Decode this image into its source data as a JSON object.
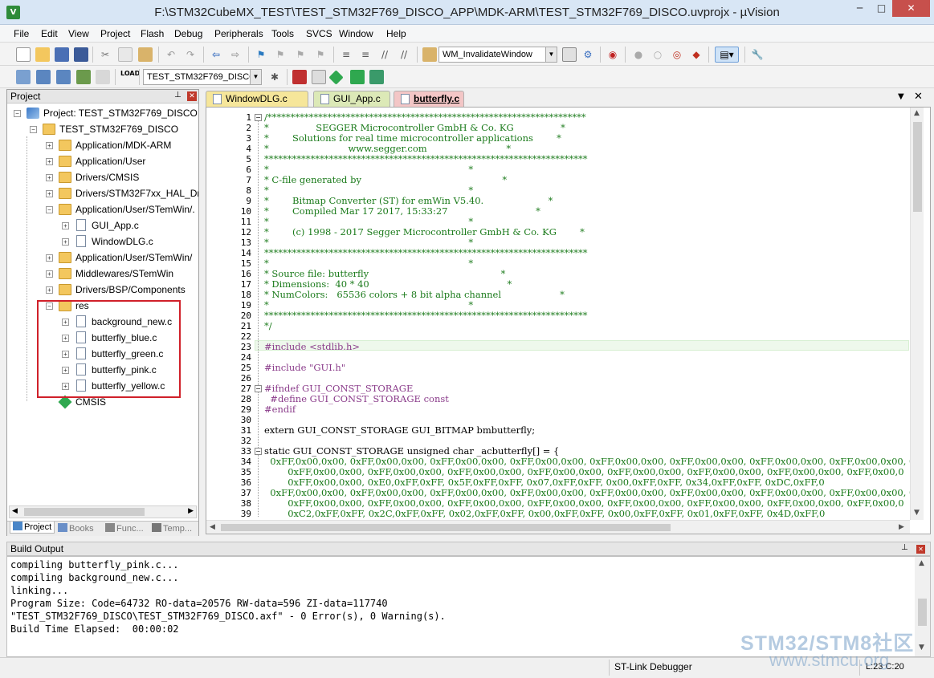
{
  "window": {
    "title": "F:\\STM32CubeMX_TEST\\TEST_STM32F769_DISCO_APP\\MDK-ARM\\TEST_STM32F769_DISCO.uvprojx - µVision",
    "min": "─",
    "max": "□",
    "close": "✕"
  },
  "menu": [
    "File",
    "Edit",
    "View",
    "Project",
    "Flash",
    "Debug",
    "Peripherals",
    "Tools",
    "SVCS",
    "Window",
    "Help"
  ],
  "toolbar": {
    "find_combo": "WM_InvalidateWindow",
    "target_combo": "TEST_STM32F769_DISCO"
  },
  "project_panel": {
    "title": "Project",
    "tree": [
      {
        "label": "Project: TEST_STM32F769_DISCO",
        "icon": "project-icon"
      },
      {
        "label": "TEST_STM32F769_DISCO",
        "icon": "target-folder-icon"
      },
      {
        "label": "Application/MDK-ARM",
        "icon": "folder-icon"
      },
      {
        "label": "Application/User",
        "icon": "folder-icon"
      },
      {
        "label": "Drivers/CMSIS",
        "icon": "folder-icon"
      },
      {
        "label": "Drivers/STM32F7xx_HAL_Driv",
        "icon": "folder-icon"
      },
      {
        "label": "Application/User/STemWin/.",
        "icon": "folder-icon"
      },
      {
        "label": "GUI_App.c",
        "icon": "file-icon"
      },
      {
        "label": "WindowDLG.c",
        "icon": "file-icon"
      },
      {
        "label": "Application/User/STemWin/",
        "icon": "folder-icon"
      },
      {
        "label": "Middlewares/STemWin",
        "icon": "folder-icon"
      },
      {
        "label": "Drivers/BSP/Components",
        "icon": "folder-icon"
      },
      {
        "label": "res",
        "icon": "folder-icon"
      },
      {
        "label": "background_new.c",
        "icon": "file-icon"
      },
      {
        "label": "butterfly_blue.c",
        "icon": "file-icon"
      },
      {
        "label": "butterfly_green.c",
        "icon": "file-icon"
      },
      {
        "label": "butterfly_pink.c",
        "icon": "file-icon"
      },
      {
        "label": "butterfly_yellow.c",
        "icon": "file-icon"
      },
      {
        "label": "CMSIS",
        "icon": "cmsis-diamond-icon"
      }
    ],
    "tabs": [
      "Project",
      "Books",
      "Func...",
      "Temp..."
    ]
  },
  "editor": {
    "tabs": [
      "WindowDLG.c",
      "GUI_App.c",
      "butterfly.c"
    ],
    "active_tab": "butterfly.c",
    "lines": [
      {
        "n": "1",
        "t": "/*********************************************************************",
        "k": "c-com"
      },
      {
        "n": "2",
        "t": "*                SEGGER Microcontroller GmbH & Co. KG                *",
        "k": "c-com"
      },
      {
        "n": "3",
        "t": "*        Solutions for real time microcontroller applications        *",
        "k": "c-com"
      },
      {
        "n": "4",
        "t": "*                           www.segger.com                           *",
        "k": "c-com"
      },
      {
        "n": "5",
        "t": "**********************************************************************",
        "k": "c-com"
      },
      {
        "n": "6",
        "t": "*                                                                    *",
        "k": "c-com"
      },
      {
        "n": "7",
        "t": "* C-file generated by                                                *",
        "k": "c-com"
      },
      {
        "n": "8",
        "t": "*                                                                    *",
        "k": "c-com"
      },
      {
        "n": "9",
        "t": "*        Bitmap Converter (ST) for emWin V5.40.                      *",
        "k": "c-com"
      },
      {
        "n": "10",
        "t": "*        Compiled Mar 17 2017, 15:33:27                              *",
        "k": "c-com"
      },
      {
        "n": "11",
        "t": "*                                                                    *",
        "k": "c-com"
      },
      {
        "n": "12",
        "t": "*        (c) 1998 - 2017 Segger Microcontroller GmbH & Co. KG        *",
        "k": "c-com"
      },
      {
        "n": "13",
        "t": "*                                                                    *",
        "k": "c-com"
      },
      {
        "n": "14",
        "t": "**********************************************************************",
        "k": "c-com"
      },
      {
        "n": "15",
        "t": "*                                                                    *",
        "k": "c-com"
      },
      {
        "n": "16",
        "t": "* Source file: butterfly                                             *",
        "k": "c-com"
      },
      {
        "n": "17",
        "t": "* Dimensions:  40 * 40                                               *",
        "k": "c-com"
      },
      {
        "n": "18",
        "t": "* NumColors:   65536 colors + 8 bit alpha channel                    *",
        "k": "c-com"
      },
      {
        "n": "19",
        "t": "*                                                                    *",
        "k": "c-com"
      },
      {
        "n": "20",
        "t": "**********************************************************************",
        "k": "c-com"
      },
      {
        "n": "21",
        "t": "*/",
        "k": "c-com"
      },
      {
        "n": "22",
        "t": "",
        "k": "c-norm"
      },
      {
        "n": "23",
        "t": "#include <stdlib.h>",
        "k": "c-pre"
      },
      {
        "n": "24",
        "t": "",
        "k": "c-norm"
      },
      {
        "n": "25",
        "t": "#include \"GUI.h\"",
        "k": "c-pre"
      },
      {
        "n": "26",
        "t": "",
        "k": "c-norm"
      },
      {
        "n": "27",
        "t": "#ifndef GUI_CONST_STORAGE",
        "k": "c-pre"
      },
      {
        "n": "28",
        "t": "  #define GUI_CONST_STORAGE const",
        "k": "c-pre"
      },
      {
        "n": "29",
        "t": "#endif",
        "k": "c-pre"
      },
      {
        "n": "30",
        "t": "",
        "k": "c-norm"
      },
      {
        "n": "31",
        "t": "extern GUI_CONST_STORAGE GUI_BITMAP bmbutterfly;",
        "k": "c-norm"
      },
      {
        "n": "32",
        "t": "",
        "k": "c-norm"
      },
      {
        "n": "33",
        "t": "static GUI_CONST_STORAGE unsigned char _acbutterfly[] = {",
        "k": "c-norm"
      },
      {
        "n": "34",
        "t": "  0xFF,0x00,0x00, 0xFF,0x00,0x00, 0xFF,0x00,0x00, 0xFF,0x00,0x00, 0xFF,0x00,0x00, 0xFF,0x00,0x00, 0xFF,0x00,0x00, 0xFF,0x00,0x00, 0",
        "k": "c-hex"
      },
      {
        "n": "35",
        "t": "        0xFF,0x00,0x00, 0xFF,0x00,0x00, 0xFF,0x00,0x00, 0xFF,0x00,0x00, 0xFF,0x00,0x00, 0xFF,0x00,0x00, 0xFF,0x00,0x00, 0xFF,0x00,0",
        "k": "c-hex"
      },
      {
        "n": "36",
        "t": "        0xFF,0x00,0x00, 0xE0,0xFF,0xFF, 0x5F,0xFF,0xFF, 0x07,0xFF,0xFF, 0x00,0xFF,0xFF, 0x34,0xFF,0xFF, 0xDC,0xFF,0",
        "k": "c-hex"
      },
      {
        "n": "37",
        "t": "  0xFF,0x00,0x00, 0xFF,0x00,0x00, 0xFF,0x00,0x00, 0xFF,0x00,0x00, 0xFF,0x00,0x00, 0xFF,0x00,0x00, 0xFF,0x00,0x00, 0xFF,0x00,0x00, 0",
        "k": "c-hex"
      },
      {
        "n": "38",
        "t": "        0xFF,0x00,0x00, 0xFF,0x00,0x00, 0xFF,0x00,0x00, 0xFF,0x00,0x00, 0xFF,0x00,0x00, 0xFF,0x00,0x00, 0xFF,0x00,0x00, 0xFF,0x00,0",
        "k": "c-hex"
      },
      {
        "n": "39",
        "t": "        0xC2,0xFF,0xFF, 0x2C,0xFF,0xFF, 0x02,0xFF,0xFF, 0x00,0xFF,0xFF, 0x00,0xFF,0xFF, 0x01,0xFF,0xFF, 0x4D,0xFF,0",
        "k": "c-hex"
      }
    ]
  },
  "build_output": {
    "title": "Build Output",
    "lines": [
      "compiling butterfly_pink.c...",
      "compiling background_new.c...",
      "linking...",
      "Program Size: Code=64732 RO-data=20576 RW-data=596 ZI-data=117740",
      "\"TEST_STM32F769_DISCO\\TEST_STM32F769_DISCO.axf\" - 0 Error(s), 0 Warning(s).",
      "Build Time Elapsed:  00:00:02"
    ]
  },
  "status": {
    "debugger": "ST-Link Debugger",
    "position": "L:23 C:20"
  },
  "watermark": {
    "brand": "STM32/STM8社区",
    "url": "www.stmcu.org"
  },
  "colors": {
    "comment": "#1a7a1a",
    "preprocessor": "#8a3b8a",
    "highlight_box": "#d0202a"
  }
}
